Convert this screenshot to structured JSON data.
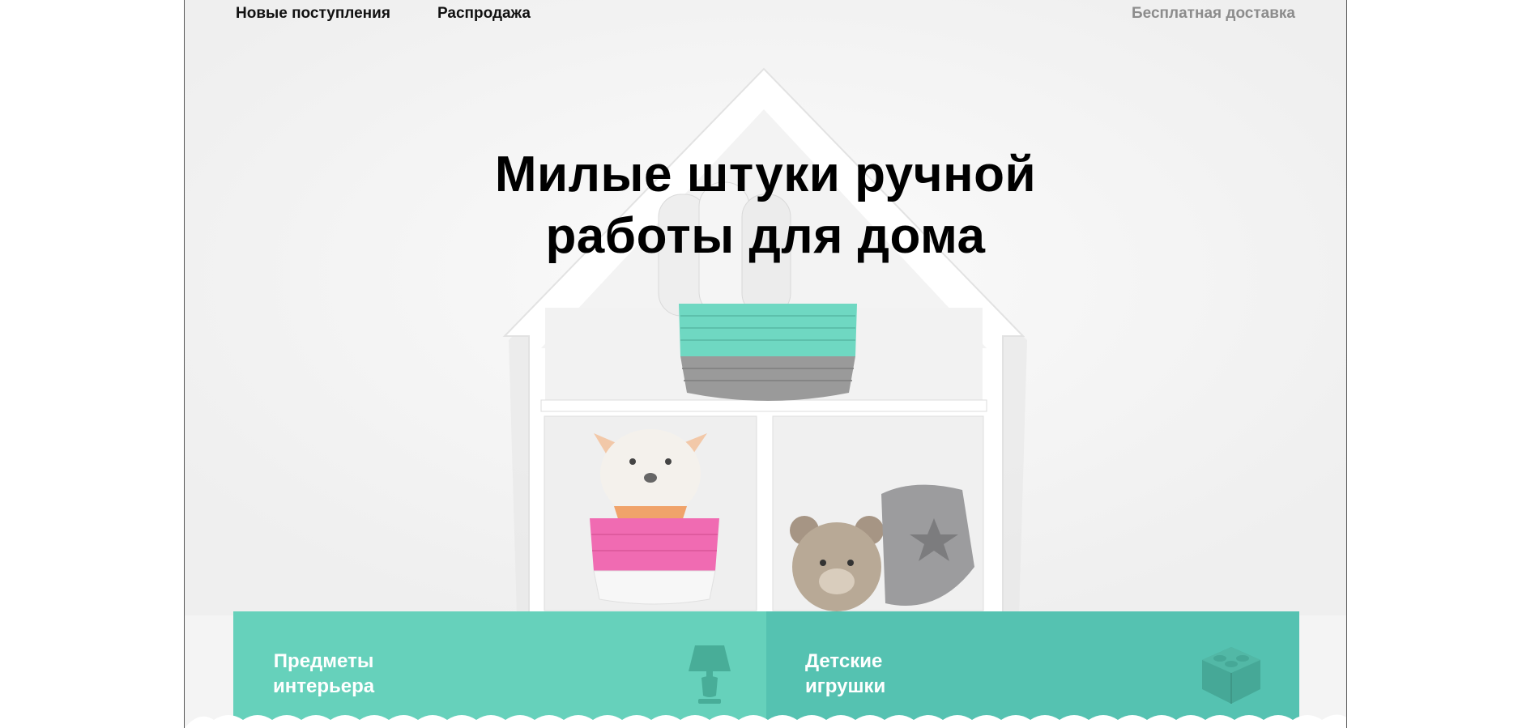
{
  "nav": {
    "new_arrivals": "Новые поступления",
    "sale": "Распродажа",
    "free_delivery": "Бесплатная доставка"
  },
  "hero": {
    "title_line1": "Милые штуки ручной",
    "title_line2": "работы для дома",
    "image": "house-shelf-with-handmade-toys"
  },
  "categories": [
    {
      "line1": "Предметы",
      "line2": "интерьера",
      "icon": "lamp-icon",
      "color": "#66d1bb"
    },
    {
      "line1": "Детские",
      "line2": "игрушки",
      "icon": "toy-brick-icon",
      "color": "#55c2b1"
    }
  ],
  "colors": {
    "accent": "#66d1bb",
    "accent_dark": "#55c2b1",
    "muted_text": "#8c8c8c"
  }
}
